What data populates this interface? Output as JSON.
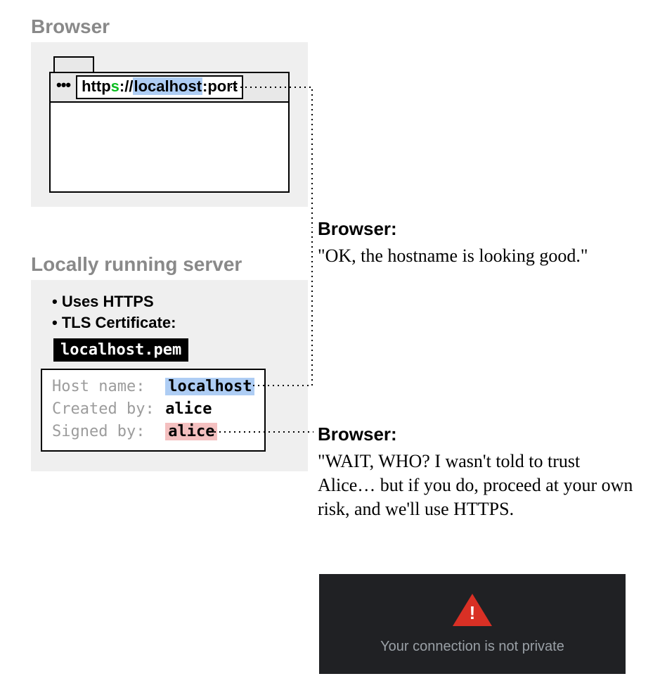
{
  "sections": {
    "browser_title": "Browser",
    "server_title": "Locally running server"
  },
  "url": {
    "http": "http",
    "s": "s",
    "sep": "://",
    "host": "localhost",
    "colon": ":",
    "port": "port",
    "dots": "•••"
  },
  "server": {
    "bullet1": "Uses HTTPS",
    "bullet2": "TLS Certificate:",
    "cert_filename": "localhost.pem"
  },
  "cert": {
    "label_host": "Host name:",
    "value_host": "localhost",
    "label_created": "Created by:",
    "value_created": "alice",
    "label_signed": "Signed by:",
    "value_signed": "alice"
  },
  "commentary": {
    "c1_heading": "Browser:",
    "c1_text": "\"OK, the hostname is looking good.\"",
    "c2_heading": "Browser:",
    "c2_text": "\"WAIT, WHO? I wasn't told to trust Alice… but if you do, proceed at your own risk, and we'll use HTTPS."
  },
  "warning": {
    "text": "Your connection is not private"
  }
}
